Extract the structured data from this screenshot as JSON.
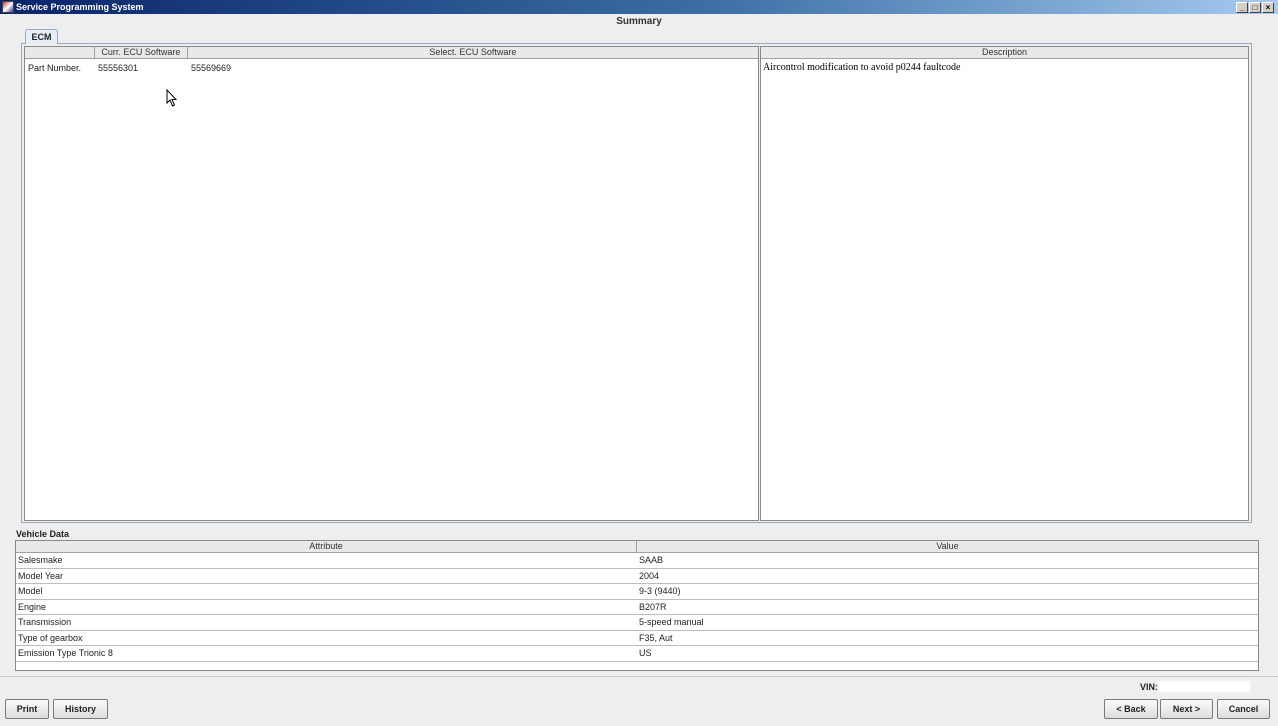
{
  "window": {
    "title": "Service Programming System"
  },
  "page": {
    "title": "Summary"
  },
  "tabs": [
    {
      "label": "ECM"
    }
  ],
  "software_table": {
    "columns": [
      "",
      "Curr. ECU Software",
      "Select. ECU Software"
    ],
    "rows": [
      {
        "label": "Part Number.",
        "current": "55556301",
        "selected": "55569669"
      }
    ]
  },
  "description_table": {
    "header": "Description",
    "text": "Aircontrol modification to avoid p0244 faultcode"
  },
  "vehicle_data": {
    "label": "Vehicle Data",
    "columns": [
      "Attribute",
      "Value"
    ],
    "rows": [
      {
        "attribute": "Salesmake",
        "value": "SAAB"
      },
      {
        "attribute": "Model Year",
        "value": "2004"
      },
      {
        "attribute": "Model",
        "value": "9-3 (9440)"
      },
      {
        "attribute": "Engine",
        "value": "B207R"
      },
      {
        "attribute": "Transmission",
        "value": "5-speed manual"
      },
      {
        "attribute": "Type of gearbox",
        "value": "F35, Aut"
      },
      {
        "attribute": "Emission Type Trionic 8",
        "value": "US"
      }
    ]
  },
  "vin": {
    "label": "VIN:"
  },
  "buttons": {
    "print": "Print",
    "history": "History",
    "back": "< Back",
    "next": "Next >",
    "cancel": "Cancel"
  },
  "icons": {
    "minimize": "minimize-icon",
    "maximize": "maximize-icon",
    "close": "close-icon",
    "cursor": "mouse-pointer-icon"
  }
}
